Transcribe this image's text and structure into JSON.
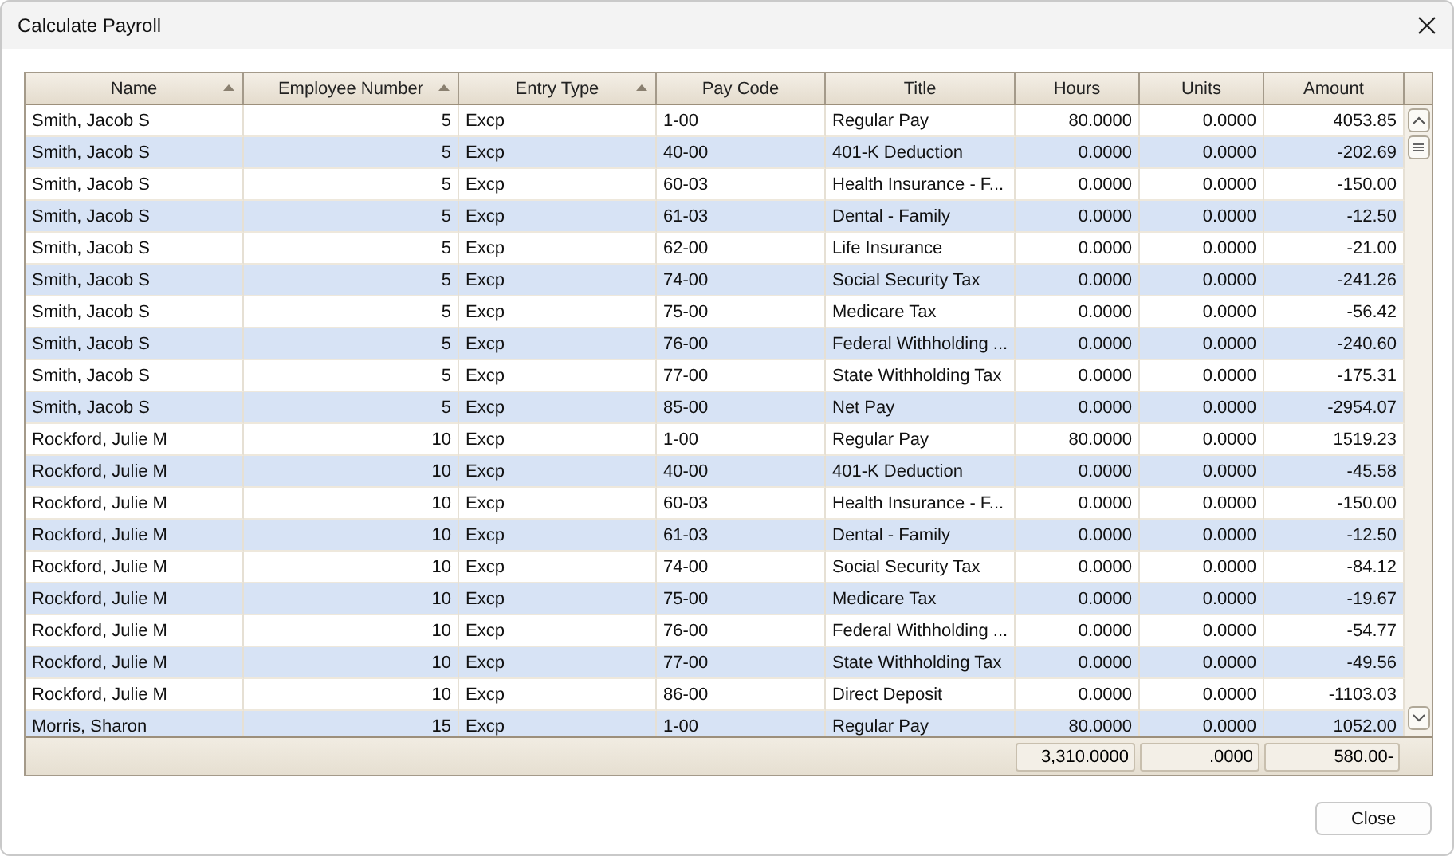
{
  "window": {
    "title": "Calculate Payroll"
  },
  "table": {
    "columns": [
      {
        "label": "Name",
        "sorted": true
      },
      {
        "label": "Employee Number",
        "sorted": true
      },
      {
        "label": "Entry Type",
        "sorted": true
      },
      {
        "label": "Pay Code",
        "sorted": false
      },
      {
        "label": "Title",
        "sorted": false
      },
      {
        "label": "Hours",
        "sorted": false
      },
      {
        "label": "Units",
        "sorted": false
      },
      {
        "label": "Amount",
        "sorted": false
      }
    ],
    "rows": [
      [
        "Smith, Jacob S",
        "5",
        "Excp",
        "1-00",
        "Regular Pay",
        "80.0000",
        "0.0000",
        "4053.85"
      ],
      [
        "Smith, Jacob S",
        "5",
        "Excp",
        "40-00",
        "401-K Deduction",
        "0.0000",
        "0.0000",
        "-202.69"
      ],
      [
        "Smith, Jacob S",
        "5",
        "Excp",
        "60-03",
        "Health Insurance - F...",
        "0.0000",
        "0.0000",
        "-150.00"
      ],
      [
        "Smith, Jacob S",
        "5",
        "Excp",
        "61-03",
        "Dental - Family",
        "0.0000",
        "0.0000",
        "-12.50"
      ],
      [
        "Smith, Jacob S",
        "5",
        "Excp",
        "62-00",
        "Life Insurance",
        "0.0000",
        "0.0000",
        "-21.00"
      ],
      [
        "Smith, Jacob S",
        "5",
        "Excp",
        "74-00",
        "Social Security Tax",
        "0.0000",
        "0.0000",
        "-241.26"
      ],
      [
        "Smith, Jacob S",
        "5",
        "Excp",
        "75-00",
        "Medicare Tax",
        "0.0000",
        "0.0000",
        "-56.42"
      ],
      [
        "Smith, Jacob S",
        "5",
        "Excp",
        "76-00",
        "Federal Withholding ...",
        "0.0000",
        "0.0000",
        "-240.60"
      ],
      [
        "Smith, Jacob S",
        "5",
        "Excp",
        "77-00",
        "State Withholding Tax",
        "0.0000",
        "0.0000",
        "-175.31"
      ],
      [
        "Smith, Jacob S",
        "5",
        "Excp",
        "85-00",
        "Net Pay",
        "0.0000",
        "0.0000",
        "-2954.07"
      ],
      [
        "Rockford, Julie M",
        "10",
        "Excp",
        "1-00",
        "Regular Pay",
        "80.0000",
        "0.0000",
        "1519.23"
      ],
      [
        "Rockford, Julie M",
        "10",
        "Excp",
        "40-00",
        "401-K Deduction",
        "0.0000",
        "0.0000",
        "-45.58"
      ],
      [
        "Rockford, Julie M",
        "10",
        "Excp",
        "60-03",
        "Health Insurance - F...",
        "0.0000",
        "0.0000",
        "-150.00"
      ],
      [
        "Rockford, Julie M",
        "10",
        "Excp",
        "61-03",
        "Dental - Family",
        "0.0000",
        "0.0000",
        "-12.50"
      ],
      [
        "Rockford, Julie M",
        "10",
        "Excp",
        "74-00",
        "Social Security Tax",
        "0.0000",
        "0.0000",
        "-84.12"
      ],
      [
        "Rockford, Julie M",
        "10",
        "Excp",
        "75-00",
        "Medicare Tax",
        "0.0000",
        "0.0000",
        "-19.67"
      ],
      [
        "Rockford, Julie M",
        "10",
        "Excp",
        "76-00",
        "Federal Withholding ...",
        "0.0000",
        "0.0000",
        "-54.77"
      ],
      [
        "Rockford, Julie M",
        "10",
        "Excp",
        "77-00",
        "State Withholding Tax",
        "0.0000",
        "0.0000",
        "-49.56"
      ],
      [
        "Rockford, Julie M",
        "10",
        "Excp",
        "86-00",
        "Direct Deposit",
        "0.0000",
        "0.0000",
        "-1103.03"
      ],
      [
        "Morris, Sharon",
        "15",
        "Excp",
        "1-00",
        "Regular Pay",
        "80.0000",
        "0.0000",
        "1052.00"
      ]
    ],
    "totals": {
      "hours": "3,310.0000",
      "units": ".0000",
      "amount": "580.00-"
    }
  },
  "buttons": {
    "close": "Close"
  }
}
